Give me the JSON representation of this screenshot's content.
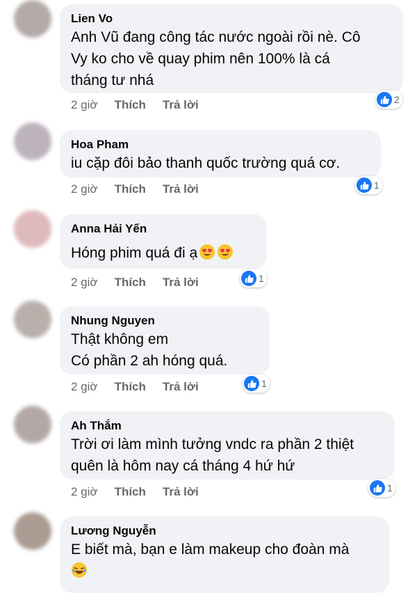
{
  "comments": [
    {
      "name": "Lien Vo",
      "text": "Anh Vũ đang công tác nước ngoài rồi nè. Cô\nVy ko cho về quay phim nên 100% là cá\ntháng tư nhá",
      "time": "2 giờ",
      "like": "Thích",
      "reply": "Trả lời",
      "reactions": "2"
    },
    {
      "name": "Hoa Pham",
      "text": "iu cặp đôi bảo thanh quốc trường quá cơ.",
      "time": "2 giờ",
      "like": "Thích",
      "reply": "Trả lời",
      "reactions": "1"
    },
    {
      "name": "Anna Hải Yến",
      "text": "Hóng phim quá đi ạ",
      "time": "2 giờ",
      "like": "Thích",
      "reply": "Trả lời",
      "reactions": "1"
    },
    {
      "name": "Nhung Nguyen",
      "text": "Thật  không  em\nCó  phần  2 ah hóng  quá.",
      "time": "2 giờ",
      "like": "Thích",
      "reply": "Trả lời",
      "reactions": "1"
    },
    {
      "name": "Ah Thắm",
      "text": "Trời ơi làm mình tưởng vndc ra phần 2 thiệt\nquên là hôm nay cá tháng 4 hứ hứ",
      "time": "2 giờ",
      "like": "Thích",
      "reply": "Trả lời",
      "reactions": "1"
    },
    {
      "name": "Lương Nguyễn",
      "text": "E biết mà, bạn e làm makeup cho đoàn mà",
      "time": "",
      "like": "",
      "reply": "",
      "reactions": ""
    }
  ],
  "colors": {
    "bubble": "#f0f2f5",
    "meta": "#65676b",
    "like_blue": "#1877f2"
  }
}
